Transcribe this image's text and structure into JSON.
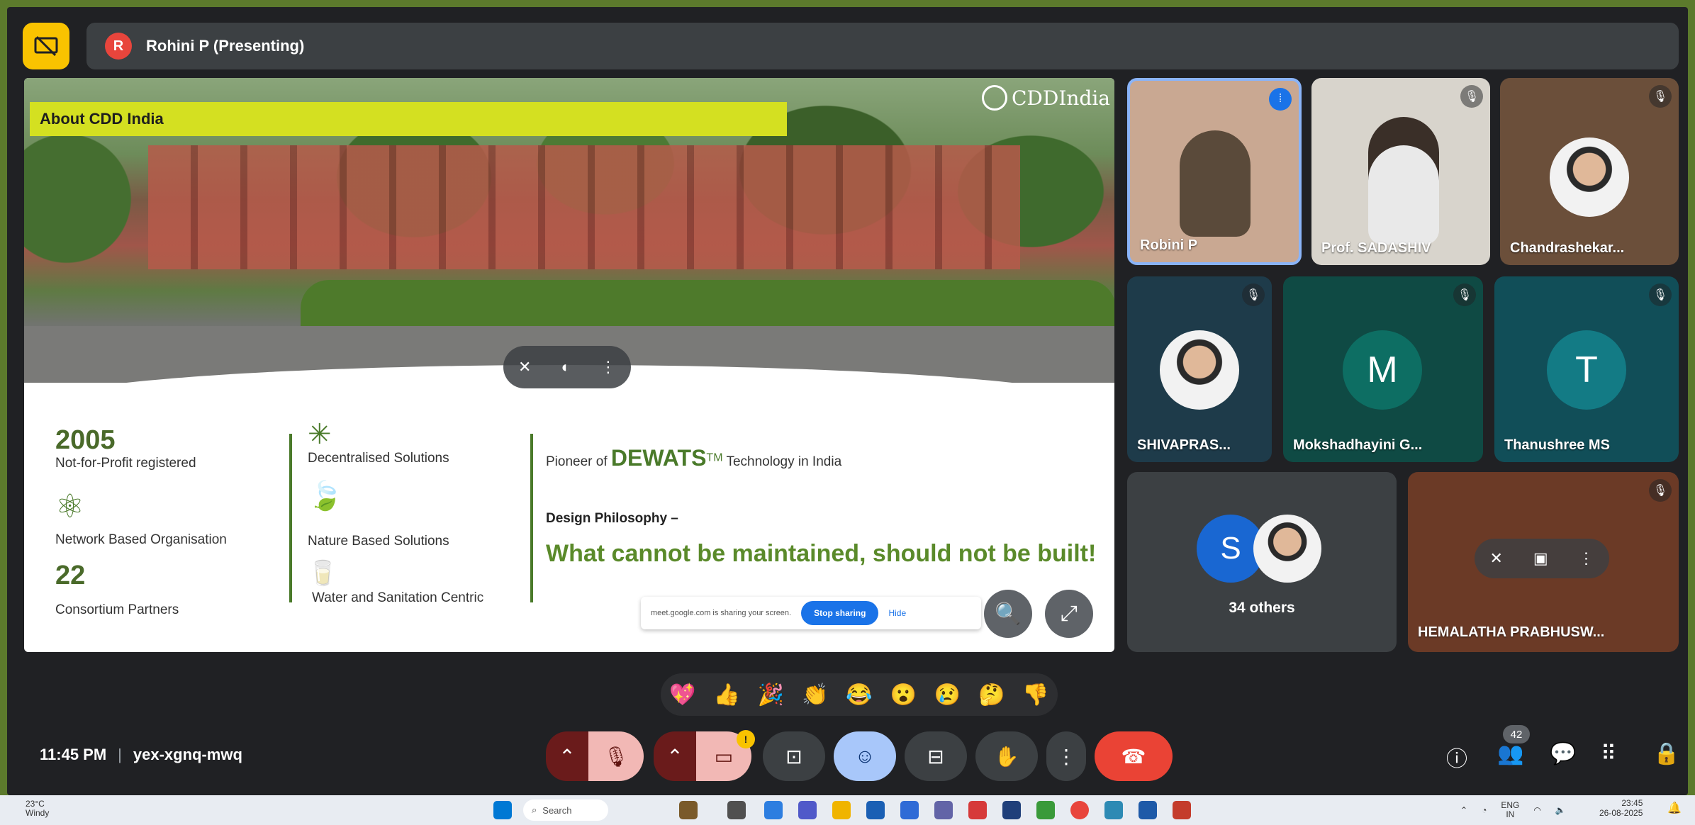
{
  "header": {
    "presenter_avatar_letter": "R",
    "presenting_text": "Rohini P (Presenting)"
  },
  "slide": {
    "title": "About CDD India",
    "logo_text": "CDDIndia",
    "stat1_number": "2005",
    "stat1_label": "Not-for-Profit registered",
    "network_label": "Network Based Organisation",
    "stat2_number": "22",
    "stat2_label": "Consortium Partners",
    "solution1": "Decentralised Solutions",
    "solution2": "Nature Based  Solutions",
    "solution3": "Water and Sanitation Centric",
    "pioneer_prefix": "Pioneer of ",
    "pioneer_brand": "DEWATS",
    "pioneer_tm": "TM",
    "pioneer_suffix": " Technology in India",
    "philosophy_label": "Design Philosophy –",
    "philosophy_quote": "What cannot be maintained, should not be built!"
  },
  "share_banner": {
    "text": "meet.google.com is sharing your screen.",
    "stop_label": "Stop sharing",
    "hide_label": "Hide"
  },
  "participants": [
    {
      "name": "Robini P"
    },
    {
      "name": "Prof. SADASHIV"
    },
    {
      "name": "Chandrashekar..."
    },
    {
      "name": "SHIVAPRAS..."
    },
    {
      "name": "Mokshadhayini G...",
      "letter": "M"
    },
    {
      "name": "Thanushree MS",
      "letter": "T"
    },
    {
      "name": "34 others",
      "letter": "S"
    },
    {
      "name": "HEMALATHA PRABHUSW..."
    }
  ],
  "reactions": [
    "💖",
    "👍",
    "🎉",
    "👏",
    "😂",
    "😮",
    "😢",
    "🤔",
    "👎"
  ],
  "meeting": {
    "time": "11:45 PM",
    "separator": "|",
    "code": "yex-xgnq-mwq"
  },
  "controls": {
    "raise_badge": "!",
    "people_count": "42"
  },
  "taskbar": {
    "temperature": "23°C",
    "weather": "Windy",
    "search_label": "Search",
    "lang": "ENG",
    "region": "IN",
    "time": "23:45",
    "date": "26-08-2025"
  },
  "colors": {
    "meet_background": "#202124",
    "slide_title_bar": "#d4e021",
    "slide_green": "#4a7a2a",
    "end_call": "#ea4335",
    "presenting_yellow": "#f9c300"
  }
}
